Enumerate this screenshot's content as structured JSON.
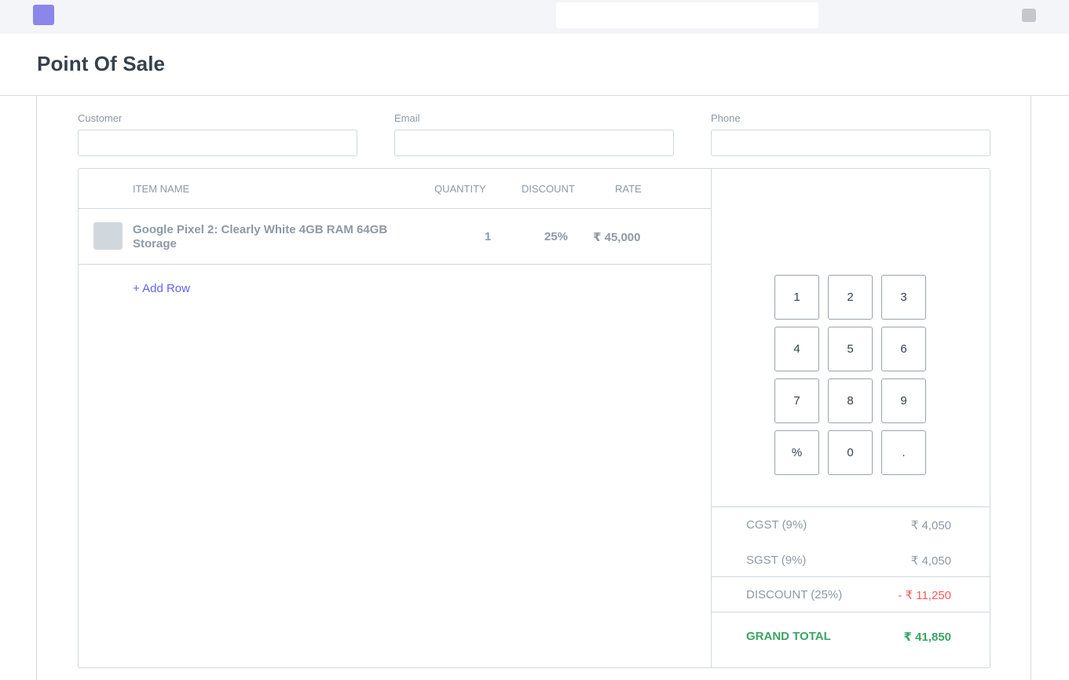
{
  "app": {
    "title": "Point Of Sale",
    "accent": "#8a86ea",
    "link_color": "#5e64ff"
  },
  "form": {
    "customer_label": "Customer",
    "email_label": "Email",
    "phone_label": "Phone",
    "customer_value": "",
    "email_value": "",
    "phone_value": ""
  },
  "table": {
    "headers": [
      "ITEM NAME",
      "QUANTITY",
      "DISCOUNT",
      "RATE"
    ],
    "rows": [
      {
        "name": "Google Pixel 2: Clearly White 4GB RAM 64GB Storage",
        "quantity": "1",
        "discount": "25%",
        "rate": "₹ 45,000"
      }
    ],
    "add_row_label": "+  Add Row"
  },
  "keypad": {
    "keys": [
      "1",
      "2",
      "3",
      "4",
      "5",
      "6",
      "7",
      "8",
      "9",
      "%",
      "0",
      "."
    ]
  },
  "summary": {
    "cgst_label": "CGST (9%)",
    "cgst_value": "₹ 4,050",
    "sgst_label": "SGST (9%)",
    "sgst_value": "₹ 4,050",
    "discount_label": "DISCOUNT (25%)",
    "discount_value": "- ₹ 11,250",
    "grand_total_label": "GRAND TOTAL",
    "grand_total_value": "₹ 41,850",
    "discount_color": "#ff5858",
    "grand_total_color": "#3aa663"
  }
}
